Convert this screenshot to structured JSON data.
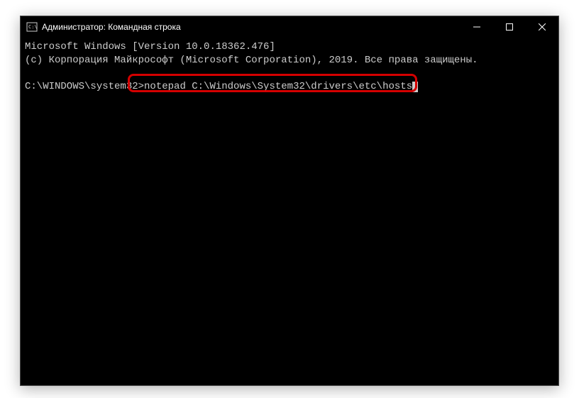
{
  "titlebar": {
    "title": "Администратор: Командная строка"
  },
  "terminal": {
    "line1": "Microsoft Windows [Version 10.0.18362.476]",
    "line2": "(c) Корпорация Майкрософт (Microsoft Corporation), 2019. Все права защищены.",
    "prompt": "C:\\WINDOWS\\system32>",
    "command": "notepad C:\\Windows\\System32\\drivers\\etc\\hosts"
  }
}
